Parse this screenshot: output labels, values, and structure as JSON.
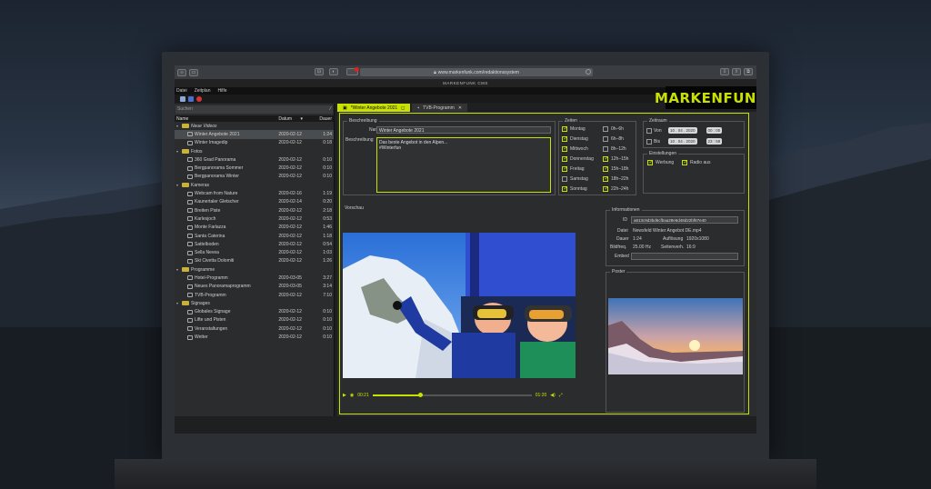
{
  "browser": {
    "url": "www.markenfunk.com/redaktionssystem"
  },
  "app": {
    "title": "MARKENFUNK CMS",
    "logo": "MARKENFUNK",
    "menu": [
      "Datei",
      "Zeitplan",
      "Hilfe"
    ]
  },
  "library": {
    "search_placeholder": "Suchen",
    "columns": {
      "name": "Name",
      "date": "Datum",
      "duration": "Dauer"
    },
    "rows": [
      {
        "type": "folder",
        "name": "Neue Videos",
        "date": "",
        "dur": ""
      },
      {
        "type": "item",
        "name": "Winter Angebote 2021",
        "date": "2020-02-12",
        "dur": "1:24",
        "selected": true
      },
      {
        "type": "item",
        "name": "Winter Imagedip",
        "date": "2020-02-12",
        "dur": "0:18"
      },
      {
        "type": "folder",
        "name": "Fotos",
        "date": "",
        "dur": ""
      },
      {
        "type": "item",
        "name": "360 Grad Panorama",
        "date": "2020-02-12",
        "dur": "0:10"
      },
      {
        "type": "item",
        "name": "Bergpanorama Sommer",
        "date": "2020-02-12",
        "dur": "0:10"
      },
      {
        "type": "item",
        "name": "Bergpanorama Winter",
        "date": "2020-02-12",
        "dur": "0:10"
      },
      {
        "type": "folder",
        "name": "Kameras",
        "date": "",
        "dur": ""
      },
      {
        "type": "item",
        "name": "Webcam from Nature",
        "date": "2020-02-16",
        "dur": "1:19"
      },
      {
        "type": "item",
        "name": "Kaunertaler Gletscher",
        "date": "2020-02-14",
        "dur": "0:20"
      },
      {
        "type": "item",
        "name": "Breiten Piste",
        "date": "2020-02-12",
        "dur": "2:18"
      },
      {
        "type": "item",
        "name": "Karlesjoch",
        "date": "2020-02-12",
        "dur": "0:53"
      },
      {
        "type": "item",
        "name": "Monte Farlazza",
        "date": "2020-02-12",
        "dur": "1:46"
      },
      {
        "type": "item",
        "name": "Santa Caterina",
        "date": "2020-02-12",
        "dur": "1:18"
      },
      {
        "type": "item",
        "name": "Sattelboden",
        "date": "2020-02-12",
        "dur": "0:54"
      },
      {
        "type": "item",
        "name": "Sella Nevea",
        "date": "2020-02-12",
        "dur": "1:03"
      },
      {
        "type": "item",
        "name": "Ski Civetta Dolomiti",
        "date": "2020-02-12",
        "dur": "1:26"
      },
      {
        "type": "folder",
        "name": "Programme",
        "date": "",
        "dur": ""
      },
      {
        "type": "item",
        "name": "Hotel-Programm",
        "date": "2020-03-05",
        "dur": "3:27"
      },
      {
        "type": "item",
        "name": "Neues Panoramaprogramm",
        "date": "2020-03-05",
        "dur": "3:14"
      },
      {
        "type": "item",
        "name": "TVB-Programm",
        "date": "2020-02-12",
        "dur": "7:10"
      },
      {
        "type": "folder",
        "name": "Signages",
        "date": "",
        "dur": ""
      },
      {
        "type": "item",
        "name": "Globales Signage",
        "date": "2020-02-12",
        "dur": "0:10"
      },
      {
        "type": "item",
        "name": "Lifte und Pisten",
        "date": "2020-02-12",
        "dur": "0:10"
      },
      {
        "type": "item",
        "name": "Veranstaltungen",
        "date": "2020-02-12",
        "dur": "0:10"
      },
      {
        "type": "item",
        "name": "Wetter",
        "date": "2020-02-12",
        "dur": "0:10"
      }
    ]
  },
  "tabs": [
    {
      "label": "*Winter Angebote 2021",
      "active": true
    },
    {
      "label": "TVB-Programm",
      "active": false
    }
  ],
  "description": {
    "group_label": "Beschreibung",
    "name_label": "Name",
    "name_value": "Winter Angebote 2021",
    "desc_label": "Beschreibung",
    "desc_line1": "Das beste Angebot in den Alpen...",
    "desc_line2": "#Winterfun"
  },
  "times": {
    "group_label": "Zeiten",
    "days": [
      {
        "label": "Montag",
        "checked": true
      },
      {
        "label": "Dienstag",
        "checked": true
      },
      {
        "label": "Mittwoch",
        "checked": true
      },
      {
        "label": "Donnerstag",
        "checked": true
      },
      {
        "label": "Freitag",
        "checked": true
      },
      {
        "label": "Samstag",
        "checked": false
      },
      {
        "label": "Sonntag",
        "checked": true
      }
    ],
    "slots": [
      {
        "label": "0h–6h",
        "checked": false
      },
      {
        "label": "6h–8h",
        "checked": false
      },
      {
        "label": "8h–12h",
        "checked": false
      },
      {
        "label": "12h–15h",
        "checked": true
      },
      {
        "label": "15h–18h",
        "checked": true
      },
      {
        "label": "18h–22h",
        "checked": true
      },
      {
        "label": "22h–24h",
        "checked": true
      }
    ]
  },
  "period": {
    "group_label": "Zeitraum",
    "from_label": "Von",
    "to_label": "Bis",
    "from_date": "10 . 04 . 2020",
    "from_time": "00 : 00",
    "to_date": "10 . 04 . 2020",
    "to_time": "23 : 59"
  },
  "settings": {
    "group_label": "Einstellungen",
    "ads_label": "Werbung",
    "radio_label": "Radio aus"
  },
  "preview": {
    "label": "Vorschau",
    "current_time": "00:21",
    "total_time": "01:20",
    "progress": 0.3
  },
  "info": {
    "group_label": "Informationen",
    "id_label": "ID",
    "id_value": "a613c9d3bd6cfbaa28e6d48d22bf67e40",
    "file_label": "Datei",
    "file_value": "Newsfeld Winter Angebot DE.mp4",
    "duration_label": "Dauer",
    "duration_value": "1:24",
    "resolution_label": "Auflösung",
    "resolution_value": "1920x1080",
    "fps_label": "Bildfreq.",
    "fps_value": "25.00 Hz",
    "aspect_label": "Seitenverh.",
    "aspect_value": "16:9",
    "embed_label": "Embed"
  },
  "poster": {
    "label": "Poster"
  },
  "colors": {
    "accent": "#c8e100",
    "panel": "#2a2c2e"
  }
}
